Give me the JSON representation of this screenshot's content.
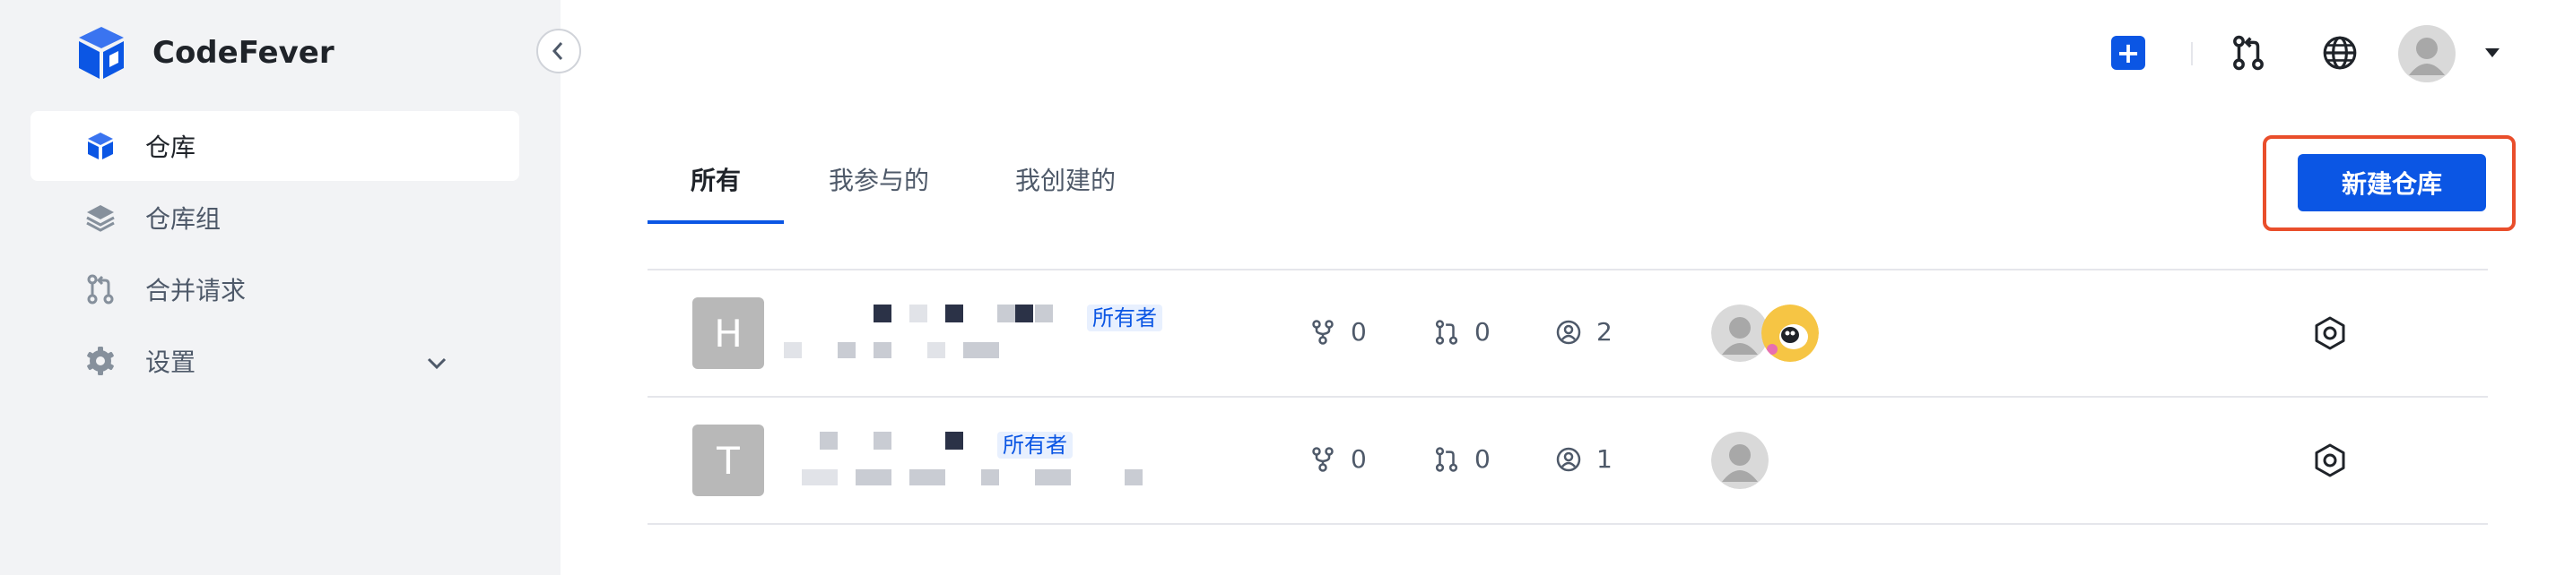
{
  "app": {
    "name": "CodeFever"
  },
  "sidebar": {
    "items": [
      {
        "label": "仓库",
        "icon": "cube-icon",
        "active": true
      },
      {
        "label": "仓库组",
        "icon": "layers-icon"
      },
      {
        "label": "合并请求",
        "icon": "merge-request-icon"
      },
      {
        "label": "设置",
        "icon": "gear-icon",
        "expandable": true
      }
    ],
    "collapse_icon": "chevron-left-icon"
  },
  "header": {
    "add_label": "+",
    "icons": [
      "plus-icon",
      "merge-request-icon",
      "globe-icon",
      "user-avatar",
      "caret-down-icon"
    ]
  },
  "tabs": [
    {
      "label": "所有",
      "active": true
    },
    {
      "label": "我参与的"
    },
    {
      "label": "我创建的"
    }
  ],
  "new_repo_button": {
    "label": "新建仓库"
  },
  "repos": [
    {
      "initial": "H",
      "badge": "所有者",
      "forks": "0",
      "merge_requests": "0",
      "members": "2"
    },
    {
      "initial": "T",
      "badge": "所有者",
      "forks": "0",
      "merge_requests": "0",
      "members": "1"
    }
  ],
  "colors": {
    "accent": "#0b56e4",
    "highlight": "#e94e2b",
    "sidebar_bg": "#f2f3f5"
  }
}
